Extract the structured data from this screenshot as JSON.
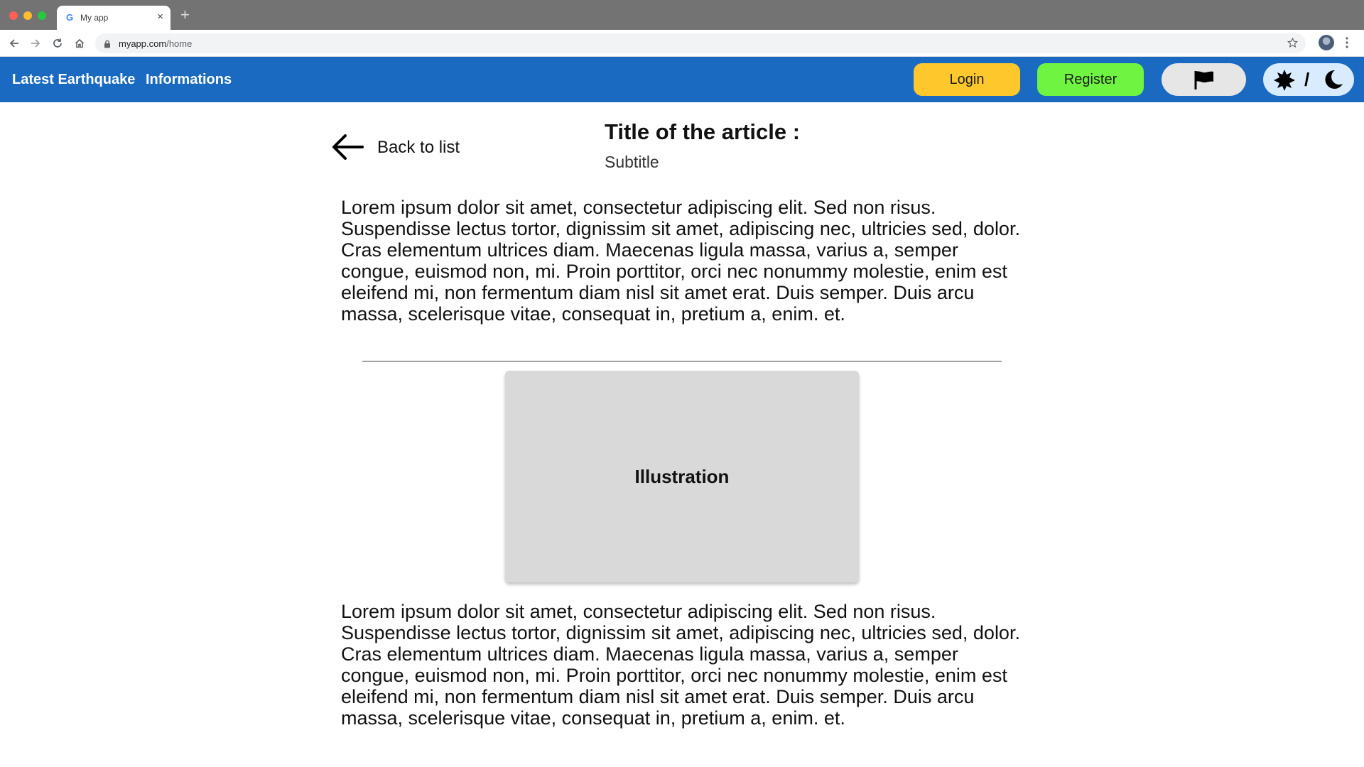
{
  "browser": {
    "tab_title": "My app",
    "tab_favicon": "G",
    "tab_close": "×",
    "new_tab": "+",
    "url_host": "myapp.com",
    "url_path": "/home"
  },
  "header": {
    "nav": [
      {
        "label": "Latest Earthquake"
      },
      {
        "label": "Informations"
      }
    ],
    "login_label": "Login",
    "register_label": "Register",
    "language_icon": "flag-icon",
    "theme_separator": "/",
    "colors": {
      "bar": "#1a6ac2",
      "login": "#fec82c",
      "register": "#6ff541",
      "language": "#e6e6e6",
      "theme": "#d9ecff"
    }
  },
  "article": {
    "back_label": "Back to list",
    "title": "Title of the article :",
    "subtitle": "Subtitle",
    "paragraph_1": "Lorem ipsum dolor sit amet, consectetur adipiscing elit. Sed non risus. Suspendisse lectus tortor, dignissim sit amet, adipiscing nec, ultricies sed, dolor. Cras elementum ultrices diam. Maecenas ligula massa, varius a, semper congue, euismod non, mi. Proin porttitor, orci nec nonummy molestie, enim est eleifend mi, non fermentum diam nisl sit amet erat. Duis semper. Duis arcu massa, scelerisque vitae, consequat in, pretium a, enim. et.",
    "illustration_label": "Illustration",
    "paragraph_2": "Lorem ipsum dolor sit amet, consectetur adipiscing elit. Sed non risus. Suspendisse lectus tortor, dignissim sit amet, adipiscing nec, ultricies sed, dolor. Cras elementum ultrices diam. Maecenas ligula massa, varius a, semper congue, euismod non, mi. Proin porttitor, orci nec nonummy molestie, enim est eleifend mi, non fermentum diam nisl sit amet erat. Duis semper. Duis arcu massa, scelerisque vitae, consequat in, pretium a, enim. et."
  }
}
